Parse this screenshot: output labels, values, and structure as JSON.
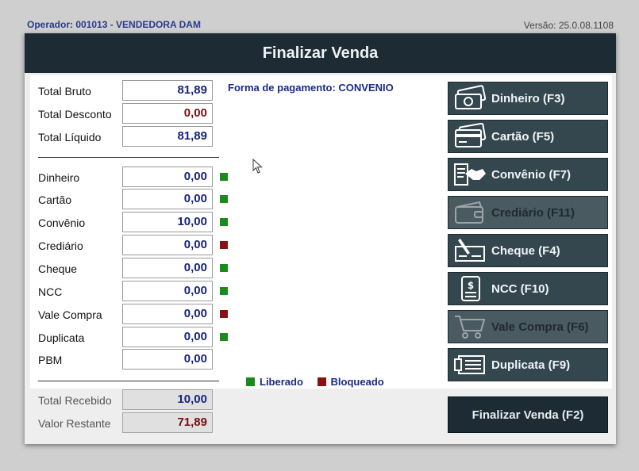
{
  "header": {
    "operator": "Operador: 001013 - VENDEDORA DAM",
    "version": "Versão: 25.0.08.1108"
  },
  "window": {
    "title": "Finalizar Venda"
  },
  "totals": {
    "bruto": {
      "label": "Total Bruto",
      "value": "81,89"
    },
    "desconto": {
      "label": "Total Desconto",
      "value": "0,00"
    },
    "liquido": {
      "label": "Total Líquido",
      "value": "81,89"
    }
  },
  "payment_form": {
    "text": "Forma de pagamento: CONVENIO"
  },
  "payments": [
    {
      "label": "Dinheiro",
      "value": "0,00",
      "status": "liberado"
    },
    {
      "label": "Cartão",
      "value": "0,00",
      "status": "liberado"
    },
    {
      "label": "Convênio",
      "value": "10,00",
      "status": "liberado"
    },
    {
      "label": "Crediário",
      "value": "0,00",
      "status": "bloqueado"
    },
    {
      "label": "Cheque",
      "value": "0,00",
      "status": "liberado"
    },
    {
      "label": "NCC",
      "value": "0,00",
      "status": "liberado"
    },
    {
      "label": "Vale Compra",
      "value": "0,00",
      "status": "bloqueado"
    },
    {
      "label": "Duplicata",
      "value": "0,00",
      "status": "liberado"
    },
    {
      "label": "PBM",
      "value": "0,00",
      "status": ""
    }
  ],
  "legend": {
    "liberado": "Liberado",
    "bloqueado": "Bloqueado"
  },
  "buttons": [
    {
      "label": "Dinheiro (F3)",
      "icon": "cash-icon",
      "enabled": true
    },
    {
      "label": "Cartão (F5)",
      "icon": "card-icon",
      "enabled": true
    },
    {
      "label": "Convênio (F7)",
      "icon": "handshake-icon",
      "enabled": true
    },
    {
      "label": "Crediário (F11)",
      "icon": "wallet-icon",
      "enabled": false
    },
    {
      "label": "Cheque (F4)",
      "icon": "cheque-icon",
      "enabled": true
    },
    {
      "label": "NCC (F10)",
      "icon": "document-dollar-icon",
      "enabled": true
    },
    {
      "label": "Vale Compra (F6)",
      "icon": "cart-icon",
      "enabled": false
    },
    {
      "label": "Duplicata (F9)",
      "icon": "receipt-icon",
      "enabled": true
    }
  ],
  "footer": {
    "recebido": {
      "label": "Total Recebido",
      "value": "10,00"
    },
    "restante": {
      "label": "Valor Restante",
      "value": "71,89"
    },
    "finalize_label": "Finalizar Venda (F2)"
  },
  "colors": {
    "title_bar": "#1c2b34",
    "button_bg": "#34474f",
    "liberado": "#1a8a1a",
    "bloqueado": "#8b1010",
    "value_blue": "#17247a",
    "value_red": "#7a0d12"
  }
}
